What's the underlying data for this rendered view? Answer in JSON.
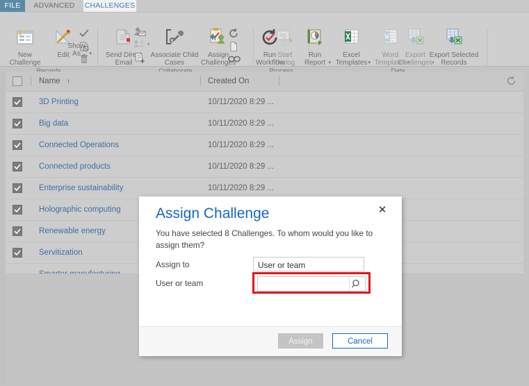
{
  "tabs": [
    {
      "label": "FILE",
      "id": "file"
    },
    {
      "label": "ADVANCED FIND",
      "id": "advanced-find"
    },
    {
      "label": "CHALLENGES",
      "id": "challenges"
    }
  ],
  "ribbon": {
    "groups": [
      {
        "label": "Records"
      },
      {
        "label": "Collaborate"
      },
      {
        "label": "Process"
      },
      {
        "label": "Data"
      }
    ],
    "commands": [
      {
        "id": "new-challenge",
        "label": "New\nChallenge",
        "icon": "new-record-icon"
      },
      {
        "id": "edit",
        "label": "Edit",
        "icon": "edit-pencil-ruler-icon"
      },
      {
        "id": "show-as",
        "label": "Show\nAs",
        "icon": "show-as-icon",
        "dropdown": true
      },
      {
        "id": "send-direct-email",
        "label": "Send Direct\nEmail",
        "icon": "email-envelope-icon"
      },
      {
        "id": "associate-child-cases",
        "label": "Associate Child\nCases",
        "icon": "wrench-bracket-icon"
      },
      {
        "id": "assign-challenges",
        "label": "Assign\nChallenges",
        "icon": "assign-clipboard-icon"
      },
      {
        "id": "run-workflow",
        "label": "Run\nWorkflow",
        "icon": "run-workflow-icon"
      },
      {
        "id": "start-dialog",
        "label": "Start\nDialog",
        "icon": "start-dialog-icon"
      },
      {
        "id": "run-report",
        "label": "Run\nReport",
        "icon": "run-report-icon",
        "dropdown": true
      },
      {
        "id": "excel-templates",
        "label": "Excel\nTemplates",
        "icon": "excel-icon",
        "dropdown": true
      },
      {
        "id": "word-templates",
        "label": "Word\nTemplates",
        "icon": "word-icon",
        "dropdown": true
      },
      {
        "id": "export-challenges",
        "label": "Export\nChallenges",
        "icon": "export-excel-icon",
        "dropdown": true
      },
      {
        "id": "export-selected-records",
        "label": "Export Selected\nRecords",
        "icon": "export-selected-excel-icon"
      }
    ],
    "mini_commands": [
      {
        "id": "activate",
        "icon": "checkmark-icon"
      },
      {
        "id": "deactivate",
        "icon": "document-deactivate-icon"
      },
      {
        "id": "delete",
        "icon": "trash-icon"
      },
      {
        "id": "send-email-contact",
        "icon": "contact-email-icon"
      },
      {
        "id": "connect",
        "icon": "connect-people-icon",
        "dropdown": true
      },
      {
        "id": "add-to-queue",
        "icon": "add-document-icon"
      },
      {
        "id": "refresh-records",
        "icon": "refresh-circle-icon"
      },
      {
        "id": "copy-link",
        "icon": "document-blank-icon"
      },
      {
        "id": "email-a-link",
        "icon": "chain-link-icon"
      }
    ]
  },
  "grid": {
    "select_all_checked": false,
    "refresh_icon": "refresh-icon",
    "columns": [
      {
        "id": "name",
        "label": "Name",
        "sort": "↑"
      },
      {
        "id": "created-on",
        "label": "Created On",
        "sort": ""
      }
    ],
    "rows": [
      {
        "name": "3D Printing",
        "created_on": "10/11/2020 8:29 ...",
        "checked": true
      },
      {
        "name": "Big data",
        "created_on": "10/11/2020 8:29 ...",
        "checked": true
      },
      {
        "name": "Connected Operations",
        "created_on": "10/11/2020 8:29 ...",
        "checked": true
      },
      {
        "name": "Connected products",
        "created_on": "10/11/2020 8:29 ...",
        "checked": true
      },
      {
        "name": "Enterprise sustainability",
        "created_on": "10/11/2020 8:29 ...",
        "checked": true
      },
      {
        "name": "Holographic computing",
        "created_on": "",
        "checked": true
      },
      {
        "name": "Renewable energy",
        "created_on": "",
        "checked": true
      },
      {
        "name": "Servitization",
        "created_on": "",
        "checked": true
      },
      {
        "name": "Smarter manufacturing",
        "created_on": "",
        "checked": false
      }
    ]
  },
  "dialog": {
    "title": "Assign Challenge",
    "close_label": "✕",
    "description": "You have selected 8 Challenges. To whom would you like to assign them?",
    "fields": [
      {
        "id": "assign-to",
        "label": "Assign to",
        "value": "User or team",
        "placeholder": ""
      },
      {
        "id": "user-or-team",
        "label": "User or team",
        "value": "",
        "placeholder": "",
        "lookup_icon": "search-icon",
        "highlighted": true
      }
    ],
    "buttons": [
      {
        "id": "assign",
        "label": "Assign",
        "state": "disabled"
      },
      {
        "id": "cancel",
        "label": "Cancel",
        "state": "default"
      }
    ],
    "highlight_color": "#e8121a",
    "accent_color": "#1268c3"
  }
}
